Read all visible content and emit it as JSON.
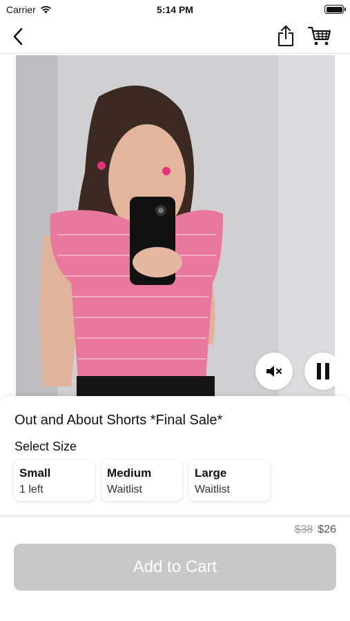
{
  "status_bar": {
    "carrier": "Carrier",
    "time": "5:14 PM",
    "wifi_icon": "wifi-icon",
    "battery_icon": "battery-icon"
  },
  "nav": {
    "back_icon": "chevron-left-icon",
    "share_icon": "share-icon",
    "cart_icon": "cart-icon"
  },
  "video": {
    "mute_icon": "speaker-muted-icon",
    "pause_icon": "pause-icon"
  },
  "product": {
    "title": "Out and About Shorts *Final Sale*",
    "select_size_label": "Select Size",
    "sizes": [
      {
        "name": "Small",
        "status": "1 left"
      },
      {
        "name": "Medium",
        "status": "Waitlist"
      },
      {
        "name": "Large",
        "status": "Waitlist"
      }
    ],
    "price_original": "$38",
    "price_sale": "$26",
    "add_to_cart_label": "Add to Cart"
  },
  "colors": {
    "button_disabled": "#c8c8c8",
    "top_pink": "#e8789e",
    "background": "#ffffff"
  }
}
